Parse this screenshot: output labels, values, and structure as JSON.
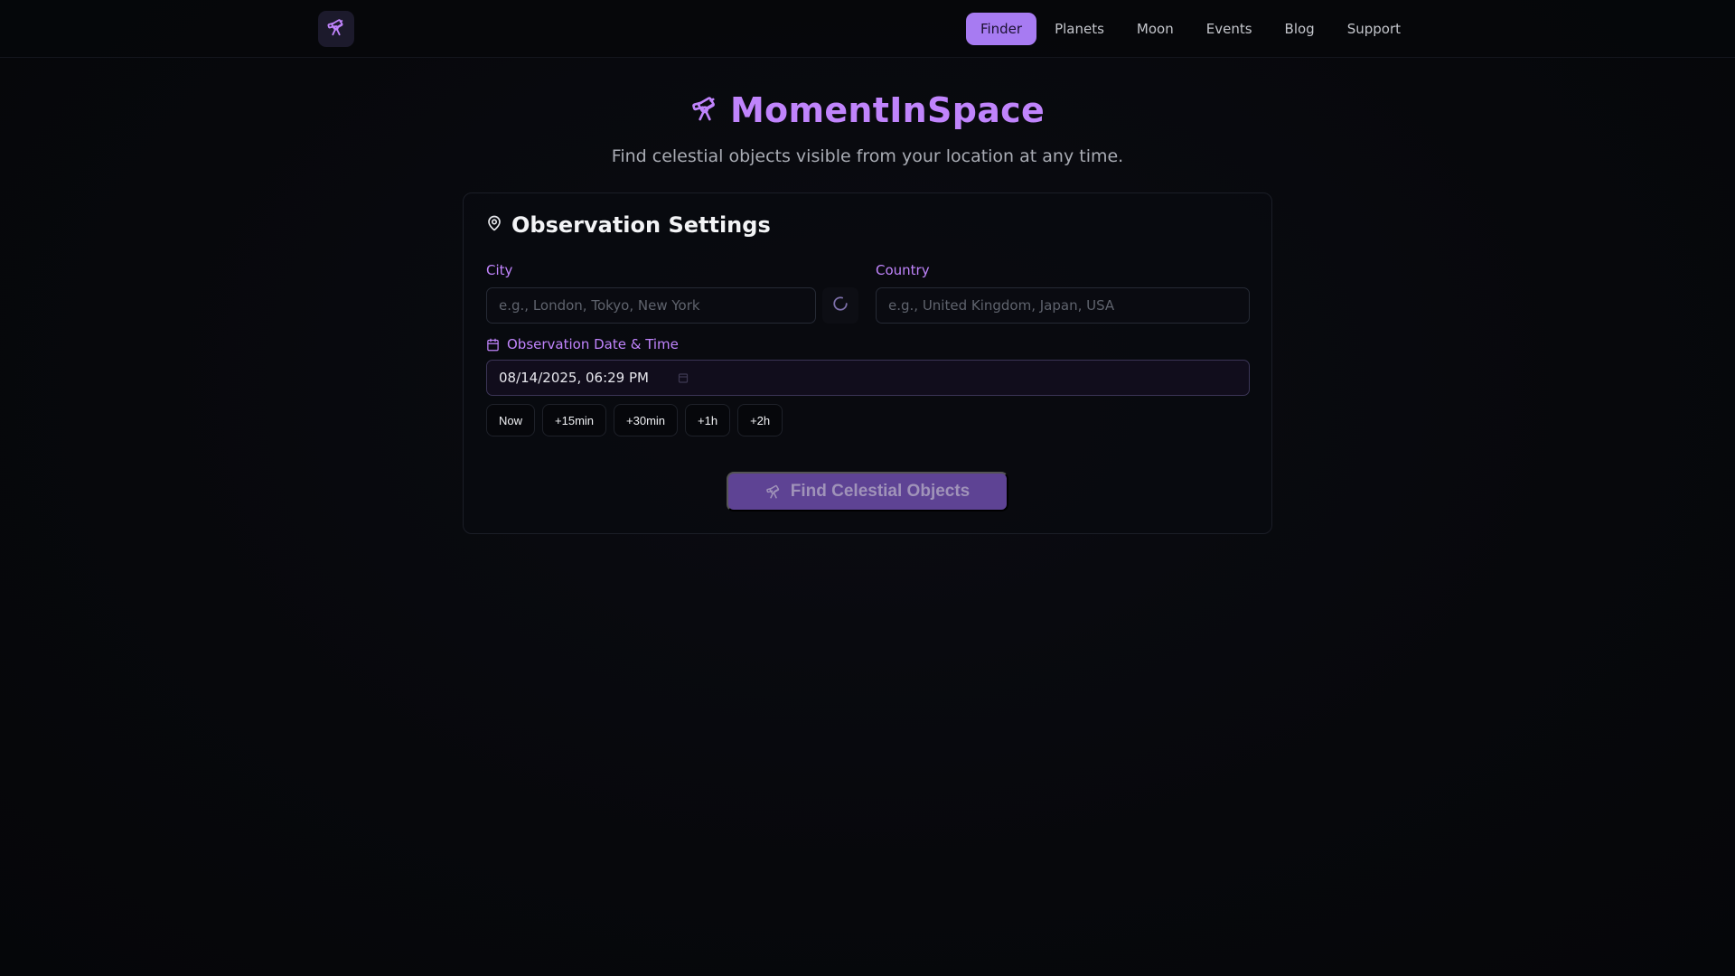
{
  "nav": {
    "logo_icon": "telescope-icon",
    "items": [
      "Finder",
      "Planets",
      "Moon",
      "Events",
      "Blog",
      "Support"
    ],
    "active": "Finder"
  },
  "hero": {
    "title": "MomentInSpace",
    "subtitle": "Find celestial objects visible from your location at any time.",
    "icon": "telescope-icon"
  },
  "settings": {
    "title": "Observation Settings",
    "icon": "map-pin-icon",
    "city": {
      "label": "City",
      "placeholder": "e.g., London, Tokyo, New York",
      "value": ""
    },
    "country": {
      "label": "Country",
      "placeholder": "e.g., United Kingdom, Japan, USA",
      "value": ""
    },
    "datetime": {
      "label": "Observation Date & Time",
      "icon": "calendar-icon",
      "value": "08/14/2025, 06:29 PM"
    },
    "quick_buttons": [
      "Now",
      "+15min",
      "+30min",
      "+1h",
      "+2h"
    ],
    "submit_label": "Find Celestial Objects"
  },
  "colors": {
    "accent": "#c084fc",
    "active_nav": "#a77bf2",
    "submit_bg": "#5e4394"
  }
}
